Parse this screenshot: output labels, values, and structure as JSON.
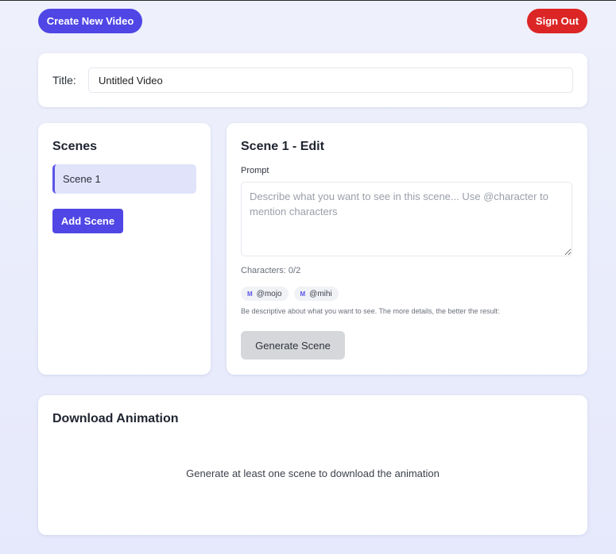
{
  "header": {
    "create_label": "Create New Video",
    "signout_label": "Sign Out"
  },
  "title_section": {
    "label": "Title:",
    "value": "Untitled Video"
  },
  "scenes_panel": {
    "heading": "Scenes",
    "items": [
      {
        "label": "Scene 1",
        "selected": true
      }
    ],
    "add_label": "Add Scene"
  },
  "editor": {
    "heading": "Scene 1 - Edit",
    "prompt_label": "Prompt",
    "prompt_placeholder": "Describe what you want to see in this scene... Use @character to mention characters",
    "char_count": "Characters: 0/2",
    "characters": [
      {
        "initial": "M",
        "handle": "@mojo"
      },
      {
        "initial": "M",
        "handle": "@mihi"
      }
    ],
    "hint": "Be descriptive about what you want to see. The more details, the better the result:",
    "generate_label": "Generate Scene"
  },
  "download": {
    "heading": "Download Animation",
    "message": "Generate at least one scene to download the animation"
  },
  "colors": {
    "accent": "#4f46e5",
    "danger": "#dc2626",
    "selected_bg": "#e1e3fa",
    "disabled_button": "#d6d7db"
  }
}
